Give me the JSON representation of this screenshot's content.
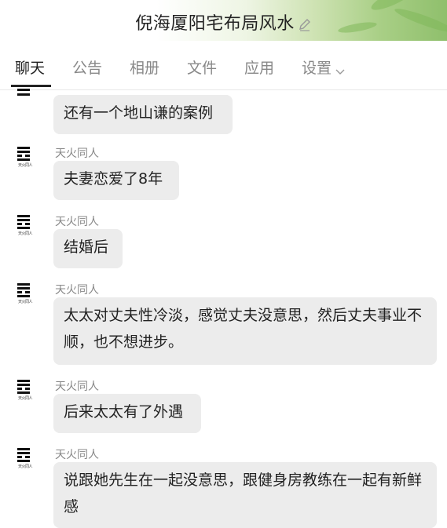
{
  "header": {
    "title": "倪海厦阳宅布局风水",
    "edit_icon": "pencil-icon"
  },
  "tabs": [
    {
      "label": "聊天",
      "active": true
    },
    {
      "label": "公告"
    },
    {
      "label": "相册"
    },
    {
      "label": "文件"
    },
    {
      "label": "应用"
    },
    {
      "label": "设置",
      "has_dropdown": true
    }
  ],
  "avatar_caption": "天火同人",
  "messages": [
    {
      "sender": "",
      "text": "还有一个地山谦的案例"
    },
    {
      "sender": "天火同人",
      "text": "夫妻恋爱了8年"
    },
    {
      "sender": "天火同人",
      "text": "结婚后"
    },
    {
      "sender": "天火同人",
      "text": "太太对丈夫性冷淡，感觉丈夫没意思，然后丈夫事业不顺，也不想进步。"
    },
    {
      "sender": "天火同人",
      "text": "后来太太有了外遇"
    },
    {
      "sender": "天火同人",
      "text": "说跟她先生在一起没意思，跟健身房教练在一起有新鲜感"
    }
  ],
  "colors": {
    "bubble": "#ececec",
    "accent_green": "#8fbf6c"
  }
}
